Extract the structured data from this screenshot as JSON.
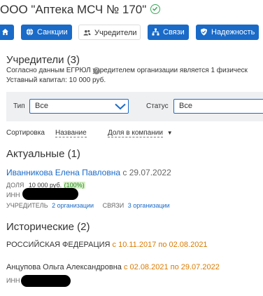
{
  "header": {
    "title": "ООО \"Аптека МСЧ № 170\""
  },
  "tabs": [
    {
      "label": ""
    },
    {
      "label": "Санкции"
    },
    {
      "label": "Учредители"
    },
    {
      "label": "Связи"
    },
    {
      "label": "Надежность"
    }
  ],
  "founders": {
    "heading": "Учредители (3)",
    "description": "Согласно данным ЕГРЮЛ учредителем организации является 1 физическ",
    "capital": "Уставный капитал: 10 000 руб."
  },
  "filters": {
    "type_label": "Тип",
    "type_value": "Все",
    "status_label": "Статус",
    "status_value": "Все"
  },
  "sort": {
    "label": "Сортировка",
    "option_name": "Название",
    "option_share": "Доля в компании"
  },
  "current": {
    "heading": "Актуальные (1)",
    "person": {
      "name": "Иванникова Елена Павловна",
      "since": "с 29.07.2022",
      "share_label": "ДОЛЯ",
      "share_value": "10 000 руб.",
      "share_percent": "(100%)",
      "inn_label": "ИНН",
      "founder_label": "УЧРЕДИТЕЛЬ",
      "founder_link": "2 организации",
      "links_label": "СВЯЗИ",
      "links_link": "3 организации"
    }
  },
  "history": {
    "heading": "Исторические (2)",
    "items": [
      {
        "name": "РОССИЙСКАЯ ФЕДЕРАЦИЯ",
        "period": "с 10.11.2017 по 02.08.2021"
      },
      {
        "name": "Анцупова Ольга Александровна",
        "period": "с 02.08.2021 по 29.07.2022",
        "inn_label": "ИНН"
      }
    ]
  },
  "colors": {
    "accent": "#1a6ac8",
    "orange": "#d97a00",
    "success": "#3aa757"
  }
}
